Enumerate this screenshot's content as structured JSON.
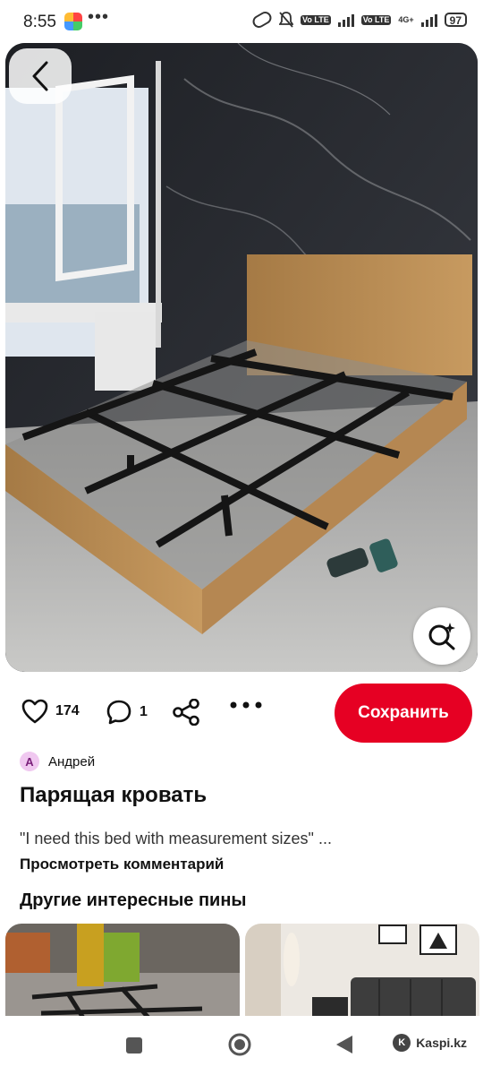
{
  "status_bar": {
    "time": "8:55",
    "dots": "•••",
    "volte1": "Vo LTE",
    "volte2": "Vo LTE",
    "network": "4G+",
    "battery": "97"
  },
  "hero": {
    "back_icon": "chevron-left-icon",
    "lens_icon": "visual-search-icon"
  },
  "actions": {
    "likes": "174",
    "comments": "1",
    "save_label": "Сохранить"
  },
  "author": {
    "initial": "А",
    "name": "Андрей"
  },
  "pin": {
    "title": "Парящая кровать",
    "comment_preview": "\"I need this bed with measurement sizes\" ...",
    "view_comments": "Просмотреть комментарий"
  },
  "more": {
    "section_title": "Другие интересные пины"
  },
  "nav": {
    "kaspi_label": "Kaspi.kz",
    "kaspi_logo_text": "K"
  },
  "colors": {
    "accent": "#e60023"
  }
}
